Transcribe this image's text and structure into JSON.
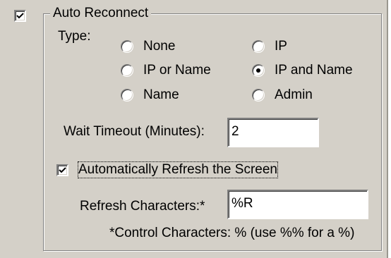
{
  "auto_reconnect": {
    "title": "Auto Reconnect",
    "checked": true
  },
  "type": {
    "label": "Type:",
    "options": [
      {
        "label": "None",
        "selected": false
      },
      {
        "label": "IP",
        "selected": false
      },
      {
        "label": "IP or Name",
        "selected": false
      },
      {
        "label": "IP and Name",
        "selected": true
      },
      {
        "label": "Name",
        "selected": false
      },
      {
        "label": "Admin",
        "selected": false
      }
    ]
  },
  "wait_timeout": {
    "label": "Wait Timeout (Minutes):",
    "value": "2"
  },
  "refresh": {
    "label": "Automatically Refresh the Screen",
    "checked": true,
    "chars_label": "Refresh Characters:*",
    "chars_value": "%R",
    "note": "*Control Characters: % (use %% for a %)"
  }
}
